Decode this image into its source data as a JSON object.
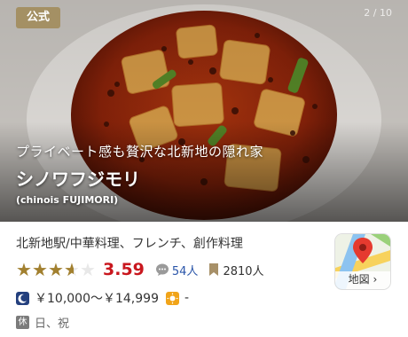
{
  "hero": {
    "official_label": "公式",
    "counter": "2 / 10",
    "tagline": "プライベート感も贅沢な北新地の隠れ家",
    "name": "シノワフジモリ",
    "subname": "(chinois FUJIMORI)"
  },
  "info": {
    "genre": "北新地駅/中華料理、フレンチ、創作料理",
    "rating": 3.59,
    "rating_text": "3.59",
    "review_count": "54人",
    "save_count": "2810人",
    "dinner_price": "￥10,000～￥14,999",
    "lunch_price": "-",
    "closed_label": "休",
    "closed_days": "日、祝"
  },
  "map_button": {
    "label": "地図"
  },
  "icons": {
    "comment": "comment-icon",
    "bookmark": "bookmark-icon",
    "dinner": "moon-icon",
    "lunch": "sun-icon",
    "map": "map-pin-icon"
  },
  "colors": {
    "official_badge": "#a49064",
    "score": "#c9171e",
    "star_fill": "#a2802f",
    "review_link": "#2a55a9",
    "dinner_icon": "#24407e",
    "lunch_icon": "#f1a419"
  }
}
